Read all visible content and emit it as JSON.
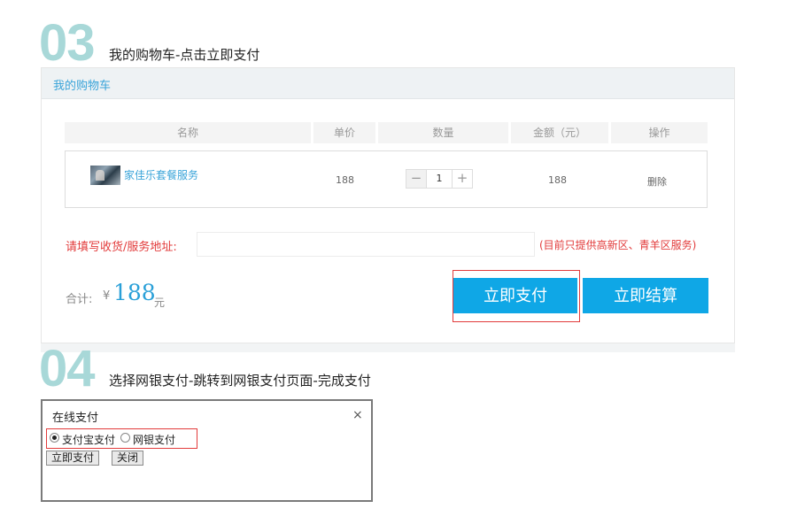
{
  "step3": {
    "number": "03",
    "title": "我的购物车-点击立即支付"
  },
  "cart": {
    "header": "我的购物车",
    "columns": [
      "名称",
      "单价",
      "数量",
      "金额（元）",
      "操作"
    ],
    "item": {
      "name": "家佳乐套餐服务",
      "price": "188",
      "quantity": "1",
      "amount": "188",
      "action": "删除"
    },
    "minus_label": "−",
    "plus_label": "+",
    "address_label": "请填写收货/服务地址:",
    "address_value": "",
    "address_note": "(目前只提供高新区、青羊区服务)",
    "total_label": "合计:",
    "currency": "¥",
    "total_value": "188",
    "total_unit": "元",
    "pay_now_label": "立即支付",
    "checkout_label": "立即结算"
  },
  "step4": {
    "number": "04",
    "title": "选择网银支付-跳转到网银支付页面-完成支付"
  },
  "dialog": {
    "title": "在线支付",
    "close_label": "×",
    "options": [
      "支付宝支付",
      "网银支付"
    ],
    "selected": "支付宝支付",
    "pay_label": "立即支付",
    "close_button_label": "关闭"
  },
  "colors": {
    "accent": "#0fa7e6",
    "link": "#3aa4d9",
    "warning": "#e23b3b",
    "step_number": "#a8d8d8"
  }
}
